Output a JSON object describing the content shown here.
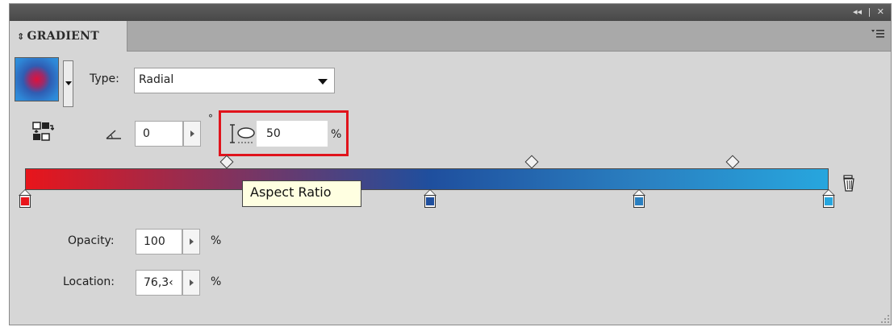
{
  "window": {
    "controls": [
      "◂◂",
      "|",
      "✕"
    ]
  },
  "panel": {
    "tab_label": "GRADIENT",
    "tab_arrows": "⇕",
    "menu_icon": "panel-menu-icon"
  },
  "gradient": {
    "type_label": "Type:",
    "type_value": "Radial",
    "angle_value": "0",
    "angle_unit": "°",
    "aspect_ratio_value": "50",
    "aspect_ratio_unit": "%",
    "tooltip": "Aspect Ratio",
    "stops": [
      {
        "location_pct": 0,
        "color": "#e8151b"
      },
      {
        "location_pct": 50.4,
        "color": "#1f4f9e"
      },
      {
        "location_pct": 76.38,
        "color": "#2a7fc0"
      },
      {
        "location_pct": 100,
        "color": "#27a6de"
      }
    ],
    "midpoints_pct": [
      25,
      63,
      88
    ]
  },
  "stop_props": {
    "opacity_label": "Opacity:",
    "opacity_value": "100",
    "opacity_unit": "%",
    "location_label": "Location:",
    "location_value": "76,3‹",
    "location_unit": "%"
  },
  "colors": {
    "accent_highlight": "#e0141c",
    "tooltip_bg": "#ffffe1",
    "panel_bg": "#d6d6d6"
  }
}
